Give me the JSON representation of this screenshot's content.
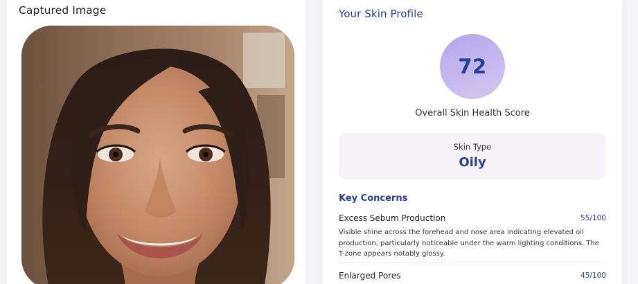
{
  "captured": {
    "title": "Captured Image",
    "photo_alt": "Captured face photo"
  },
  "profile": {
    "title": "Your Skin Profile",
    "score": "72",
    "score_label": "Overall Skin Health Score",
    "skin_type_label": "Skin Type",
    "skin_type_value": "Oily",
    "concerns_title": "Key Concerns",
    "concerns": [
      {
        "name": "Excess Sebum Production",
        "score": "55/100",
        "description": "Visible shine across the forehead and nose area indicating elevated oil production, particularly noticeable under the warm lighting conditions. The T-zone appears notably glossy."
      },
      {
        "name": "Enlarged Pores",
        "score": "45/100",
        "description": ""
      }
    ]
  },
  "colors": {
    "accent": "#283e9a",
    "score_gradient_start": "#b4a8ec",
    "score_gradient_end": "#d7c8ee",
    "skin_type_bg": "#f6f3f9",
    "page_bg": "#f6f5f8"
  }
}
